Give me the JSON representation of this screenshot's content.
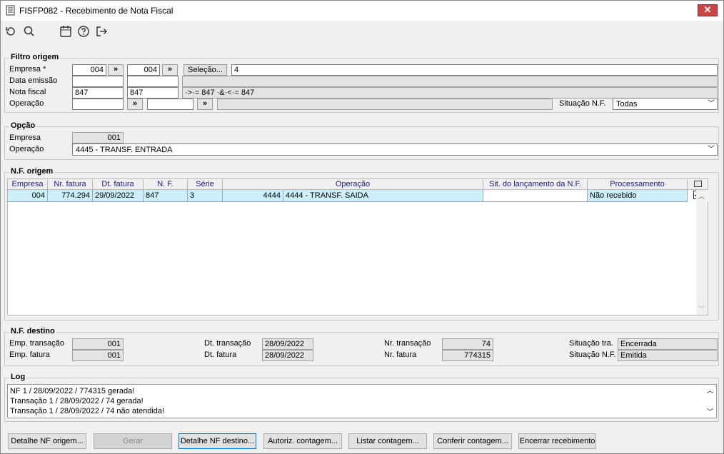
{
  "window": {
    "title": "FISFP082 - Recebimento de Nota Fiscal",
    "close": "✕"
  },
  "filtro": {
    "legend": "Filtro origem",
    "empresa_label": "Empresa *",
    "empresa_from": "004",
    "empresa_to": "004",
    "arrow": "»",
    "selecao_label": "Seleção...",
    "selecao_value": "4",
    "data_emissao_label": "Data emissão",
    "nota_fiscal_label": "Nota fiscal",
    "nota_from": "847",
    "nota_to": "847",
    "nota_expr": "·>·= 847 ·&·<·= 847",
    "operacao_label": "Operação",
    "situacao_label": "Situação N.F.",
    "situacao_value": "Todas"
  },
  "opcao": {
    "legend": "Opção",
    "empresa_label": "Empresa",
    "empresa_value": "001",
    "operacao_label": "Operação",
    "operacao_value": "4445 - TRANSF. ENTRADA"
  },
  "origem": {
    "legend": "N.F. origem",
    "columns": [
      "Empresa",
      "Nr. fatura",
      "Dt. fatura",
      "N. F.",
      "Série",
      "Operação",
      "Sit. do lançamento da N.F.",
      "Processamento"
    ],
    "row": {
      "empresa": "004",
      "nr_fatura": "774.294",
      "dt_fatura": "29/09/2022",
      "nf": "847",
      "serie": "3",
      "op_code": "4444",
      "op_desc": "4444 - TRANSF. SAIDA",
      "sit": "",
      "processamento": "Não recebido",
      "checked": true
    }
  },
  "destino": {
    "legend": "N.F. destino",
    "emp_transacao_label": "Emp. transação",
    "emp_transacao": "001",
    "emp_fatura_label": "Emp. fatura",
    "emp_fatura": "001",
    "dt_transacao_label": "Dt. transação",
    "dt_transacao": "28/09/2022",
    "dt_fatura_label": "Dt. fatura",
    "dt_fatura": "28/09/2022",
    "nr_transacao_label": "Nr. transação",
    "nr_transacao": "74",
    "nr_fatura_label": "Nr. fatura",
    "nr_fatura": "774315",
    "sit_tra_label": "Situação tra.",
    "sit_tra": "Encerrada",
    "sit_nf_label": "Situação N.F.",
    "sit_nf": "Emitida"
  },
  "log": {
    "legend": "Log",
    "lines": [
      "NF 1 / 28/09/2022 / 774315 gerada!",
      "Transação 1 / 28/09/2022 / 74 gerada!",
      "Transação 1 / 28/09/2022 / 74 não atendida!"
    ]
  },
  "buttons": {
    "detalhe_origem": "Detalhe NF origem...",
    "gerar": "Gerar",
    "detalhe_destino": "Detalhe NF destino...",
    "autoriz": "Autoriz. contagem...",
    "listar": "Listar contagem...",
    "conferir": "Conferir contagem...",
    "encerrar": "Encerrar recebimento"
  }
}
